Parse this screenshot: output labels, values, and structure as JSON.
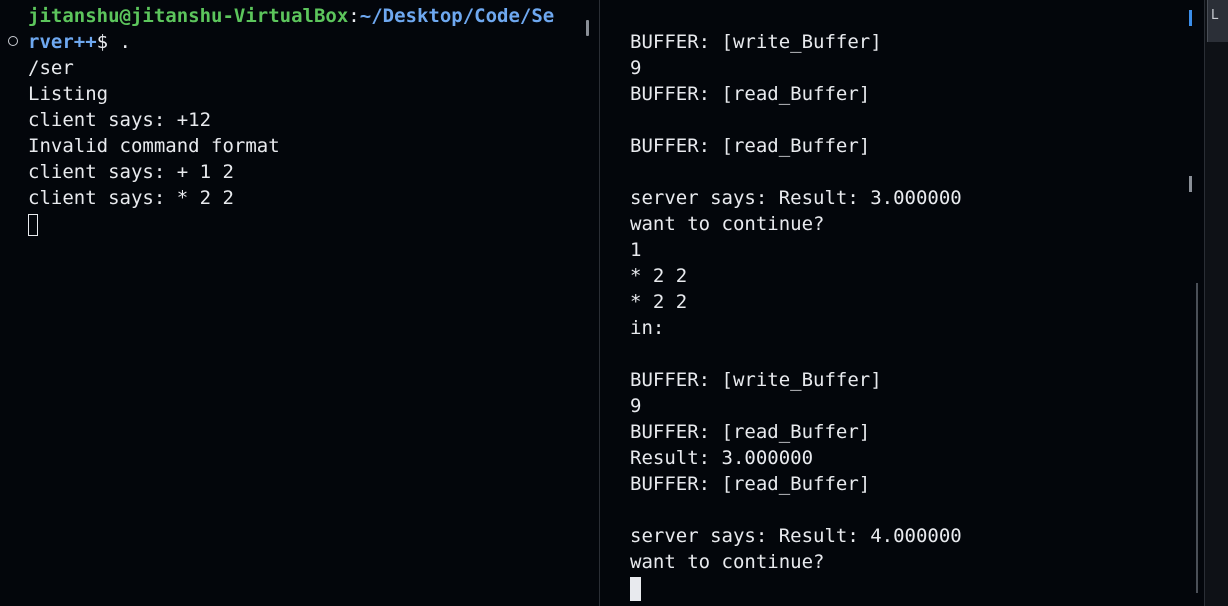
{
  "left_terminal": {
    "prompt_user_host": "jitanshu@jitanshu-VirtualBox",
    "prompt_colon": ":",
    "prompt_path_part1": "~/Desktop/Code/Se",
    "prompt_path_part2": "rver++",
    "prompt_symbol": "$ .",
    "lines": [
      "/ser",
      "Listing",
      "client says: +12",
      "Invalid command format",
      "client says: + 1 2",
      "client says: * 2 2"
    ]
  },
  "right_terminal": {
    "lines": [
      "BUFFER: [write_Buffer]",
      "9",
      "BUFFER: [read_Buffer]",
      "",
      "BUFFER: [read_Buffer]",
      "",
      "server says: Result: 3.000000",
      "want to continue?",
      "1",
      "* 2 2",
      "* 2 2",
      "in:",
      "",
      "BUFFER: [write_Buffer]",
      "9",
      "BUFFER: [read_Buffer]",
      "Result: 3.000000",
      "BUFFER: [read_Buffer]",
      "",
      "server says: Result: 4.000000",
      "want to continue?"
    ]
  },
  "right_strip": {
    "tab_glyph": "L"
  }
}
